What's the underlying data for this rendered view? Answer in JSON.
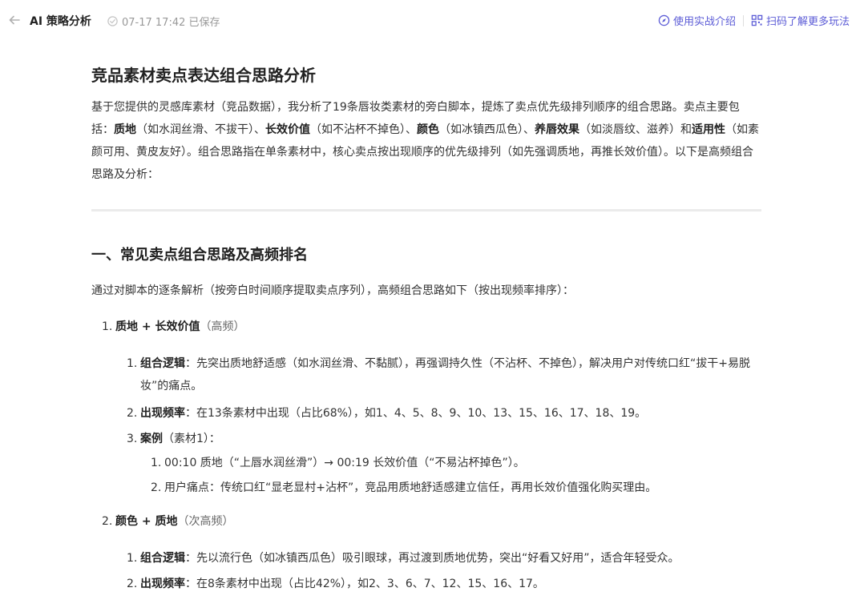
{
  "header": {
    "title": "AI 策略分析",
    "saved_text": "07-17 17:42 已保存",
    "link1": "使用实战介绍",
    "link2": "扫码了解更多玩法"
  },
  "doc": {
    "h1": "竞品素材卖点表达组合思路分析",
    "p1": [
      "基于您提供的灵感库素材（竞品数据），我分析了19条唇妆类素材的旁白脚本，提炼了卖点优先级排列顺序的组合思路。卖点主要包括：",
      "质地",
      "（如水润丝滑、不拔干）、",
      "长效价值",
      "（如不沾杯不掉色）、",
      "颜色",
      "（如冰镇西瓜色）、",
      "养唇效果",
      "（如淡唇纹、滋养）和",
      "适用性",
      "（如素颜可用、黄皮友好）。组合思路指在单条素材中，核心卖点按出现顺序的优先级排列（如先强调质地，再推长效价值）。以下是高频组合思路及分析："
    ],
    "h2": "一、常见卖点组合思路及高频排名",
    "intro": "通过对脚本的逐条解析（按旁白时间顺序提取卖点序列），高频组合思路如下（按出现频率排序）：",
    "groups": [
      {
        "num": "1.",
        "title": "质地 + 长效价值",
        "tag": "（高频）",
        "logic_num": "1.",
        "logic_label": "组合逻辑",
        "logic_text": "：先突出质地舒适感（如水润丝滑、不黏腻），再强调持久性（不沾杯、不掉色），解决用户对传统口红“拔干+易脱妆”的痛点。",
        "freq_num": "2.",
        "freq_label": "出现频率",
        "freq_text": "：在13条素材中出现（占比68%），如1、4、5、8、9、10、13、15、16、17、18、19。",
        "case_num": "3.",
        "case_label": "案例",
        "case_tag": "（素材1）：",
        "case_items": [
          {
            "num": "1.",
            "text": "00:10 质地（“上唇水润丝滑”）→ 00:19 长效价值（“不易沾杯掉色”）。"
          },
          {
            "num": "2.",
            "text": "用户痛点：传统口红“显老显村+沾杯”，竞品用质地舒适感建立信任，再用长效价值强化购买理由。"
          }
        ]
      },
      {
        "num": "2.",
        "title": "颜色 + 质地",
        "tag": "（次高频）",
        "logic_num": "1.",
        "logic_label": "组合逻辑",
        "logic_text": "：先以流行色（如冰镇西瓜色）吸引眼球，再过渡到质地优势，突出“好看又好用”，适合年轻受众。",
        "freq_num": "2.",
        "freq_label": "出现频率",
        "freq_text": "：在8条素材中出现（占比42%），如2、3、6、7、12、15、16、17。"
      }
    ]
  }
}
